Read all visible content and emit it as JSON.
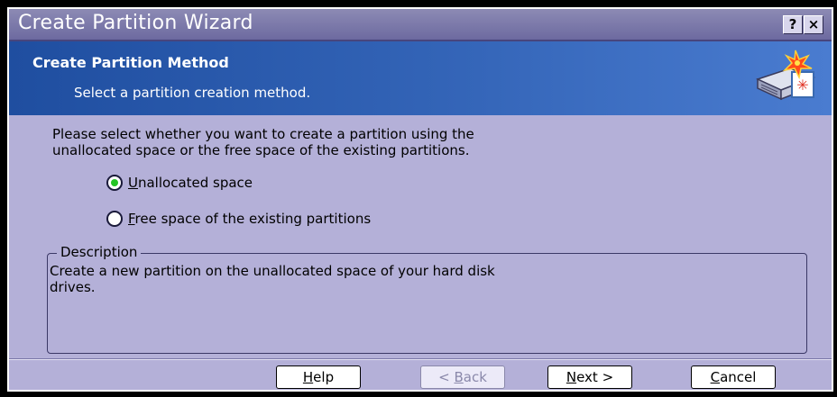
{
  "window": {
    "title": "Create Partition Wizard",
    "help_glyph": "?",
    "close_glyph": "×"
  },
  "header": {
    "title": "Create Partition Method",
    "subtitle": "Select a partition creation method.",
    "icon": "partition-wizard-icon"
  },
  "main": {
    "intro_line1": "Please select whether you want to create a partition using the",
    "intro_line2": "unallocated space or the free space of the existing partitions.",
    "options": [
      {
        "mnemonic": "U",
        "rest": "nallocated space",
        "selected": true
      },
      {
        "mnemonic": "F",
        "rest": "ree space of the existing partitions",
        "selected": false
      }
    ],
    "description": {
      "legend": "Description",
      "line1": "Create a new partition on the unallocated space of your hard disk",
      "line2": "drives."
    }
  },
  "buttons": {
    "help_mnemonic": "H",
    "help_rest": "elp",
    "back_prefix": "< ",
    "back_mnemonic": "B",
    "back_rest": "ack",
    "next_mnemonic": "N",
    "next_rest": "ext >",
    "cancel_mnemonic": "C",
    "cancel_rest": "ancel"
  },
  "colors": {
    "dialog_bg": "#b4b0d8",
    "header_bg": "#3465b8",
    "radio_checked": "#24c424"
  }
}
